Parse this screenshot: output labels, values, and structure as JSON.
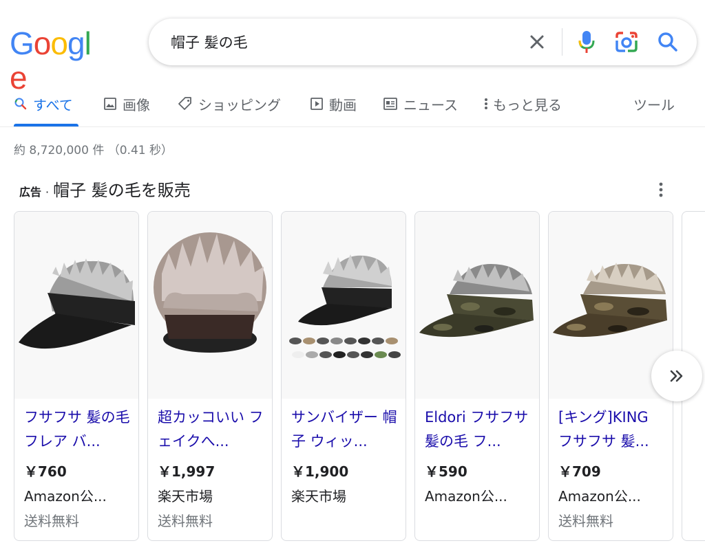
{
  "logo": {
    "letters": [
      "G",
      "o",
      "o",
      "g",
      "l",
      "e"
    ],
    "colors": [
      "#4285f4",
      "#ea4335",
      "#fbbc05",
      "#4285f4",
      "#34a853",
      "#ea4335"
    ]
  },
  "search": {
    "query": "帽子 髪の毛"
  },
  "tabs": [
    {
      "label": "すべて",
      "icon": "search-icon"
    },
    {
      "label": "画像",
      "icon": "image-icon"
    },
    {
      "label": "ショッピング",
      "icon": "tag-icon"
    },
    {
      "label": "動画",
      "icon": "play-icon"
    },
    {
      "label": "ニュース",
      "icon": "news-icon"
    },
    {
      "label": "もっと見る",
      "icon": "more-vert-icon"
    },
    {
      "label": "ツール"
    }
  ],
  "result_stats": "約 8,720,000 件 （0.41 秒）",
  "ads": {
    "label": "広告",
    "separator": "·",
    "title": "帽子 髪の毛を販売",
    "items": [
      {
        "title": "フサフサ 髪の毛 フレア バ...",
        "price": "￥760",
        "store": "Amazon公...",
        "shipping": "送料無料"
      },
      {
        "title": "超カッコいい フェイクへ...",
        "price": "￥1,997",
        "store": "楽天市場",
        "shipping": "送料無料"
      },
      {
        "title": "サンバイザー 帽子 ウィッ...",
        "price": "￥1,900",
        "store": "楽天市場",
        "shipping": ""
      },
      {
        "title": "Eldori フサフサ 髪の毛 フ...",
        "price": "￥590",
        "store": "Amazon公...",
        "shipping": ""
      },
      {
        "title": "[キング]KING フサフサ 髪...",
        "price": "￥709",
        "store": "Amazon公...",
        "shipping": "送料無料"
      }
    ]
  },
  "colors": {
    "accent": "#1a73e8",
    "link": "#1a0dab",
    "muted": "#70757a"
  }
}
